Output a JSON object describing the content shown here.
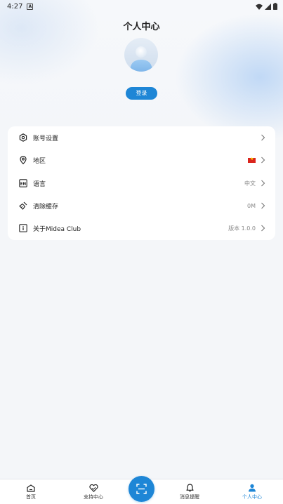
{
  "status_bar": {
    "time": "4:27",
    "icons": [
      "notification-a-icon",
      "wifi-icon",
      "cellular-icon",
      "battery-icon"
    ]
  },
  "header": {
    "title": "个人中心",
    "login_label": "登录"
  },
  "settings": {
    "items": [
      {
        "label": "账号设置",
        "value": "",
        "icon": "shield-hex-icon"
      },
      {
        "label": "地区",
        "value": "",
        "icon": "location-pin-icon",
        "flag": "vietnam-flag-icon"
      },
      {
        "label": "语言",
        "value": "中文",
        "icon": "language-en-icon"
      },
      {
        "label": "清除缓存",
        "value": "0M",
        "icon": "broom-icon"
      },
      {
        "label": "关于Midea Club",
        "value": "版本 1.0.0",
        "icon": "info-icon"
      }
    ]
  },
  "bottom_nav": {
    "items": [
      {
        "label": "首页",
        "icon": "home-icon"
      },
      {
        "label": "支持中心",
        "icon": "heart-support-icon"
      },
      {
        "label": "消息提醒",
        "icon": "bell-icon"
      },
      {
        "label": "个人中心",
        "icon": "person-icon",
        "active": true
      }
    ],
    "scan_icon": "scan-icon"
  },
  "colors": {
    "accent": "#1e86d6",
    "background": "#f4f6f9",
    "card": "#ffffff",
    "text": "#222222",
    "muted": "#888888"
  }
}
